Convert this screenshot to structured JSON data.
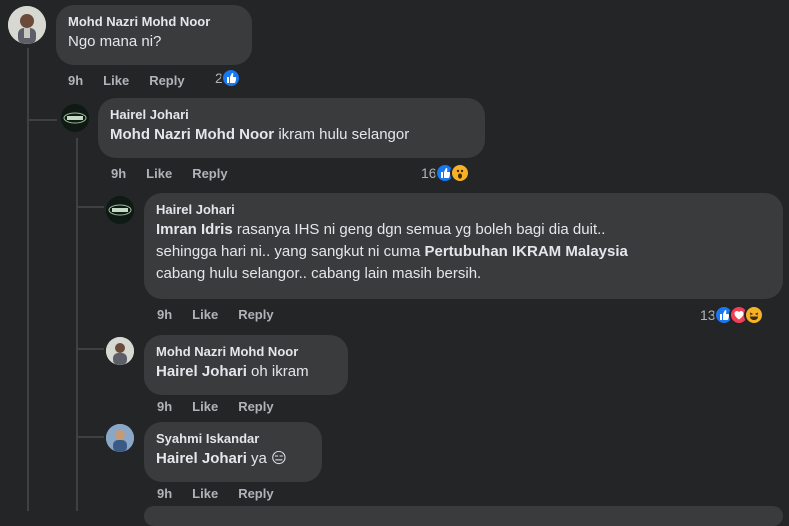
{
  "comments": [
    {
      "author": "Mohd Nazri Mohd Noor",
      "text": "Ngo mana ni?",
      "time": "9h",
      "like": "Like",
      "reply": "Reply",
      "reaction_count": "2"
    },
    {
      "author": "Hairel Johari",
      "mention": "Mohd Nazri Mohd Noor",
      "text": " ikram hulu selangor",
      "time": "9h",
      "like": "Like",
      "reply": "Reply",
      "reaction_count": "16"
    },
    {
      "author": "Hairel Johari",
      "mention": "Imran Idris",
      "text_1": " rasanya IHS ni geng dgn semua yg boleh bagi dia duit..",
      "text_2": "sehingga hari ni.. yang sangkut ni cuma ",
      "bold_org": "Pertubuhan IKRAM Malaysia",
      "text_3": "cabang hulu selangor.. cabang lain masih bersih.",
      "time": "9h",
      "like": "Like",
      "reply": "Reply",
      "reaction_count": "13"
    },
    {
      "author": "Mohd Nazri Mohd Noor",
      "mention": "Hairel Johari",
      "text": " oh ikram",
      "time": "9h",
      "like": "Like",
      "reply": "Reply"
    },
    {
      "author": "Syahmi Iskandar",
      "mention": "Hairel Johari",
      "text": " ya",
      "emoji": "😑",
      "time": "9h",
      "like": "Like",
      "reply": "Reply"
    }
  ],
  "colors": {
    "background": "#242526",
    "bubble": "#3a3b3c",
    "text": "#e4e6eb",
    "secondary": "#b0b3b8",
    "like_blue": "#1877f2",
    "love_red": "#f33e58",
    "wow_yellow": "#f7b125"
  },
  "icons": [
    "like-reaction-icon",
    "love-reaction-icon",
    "wow-reaction-icon",
    "haha-reaction-icon"
  ]
}
